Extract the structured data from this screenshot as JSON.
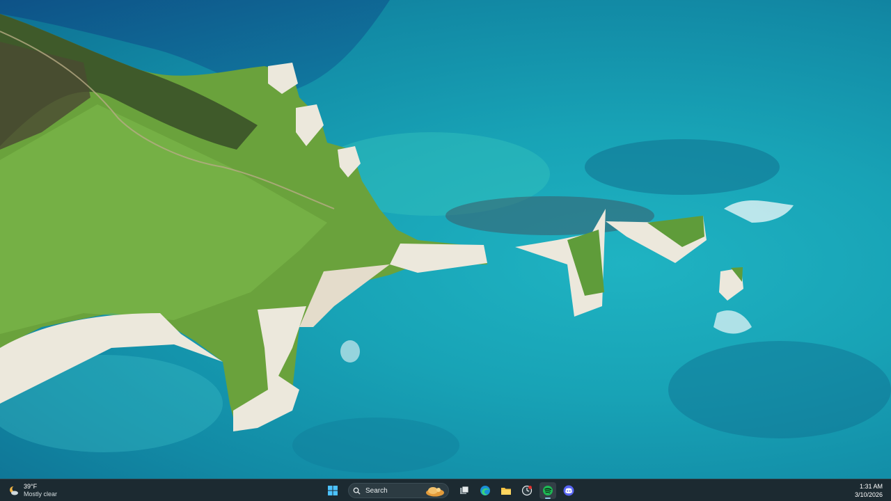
{
  "taskbar": {
    "weather": {
      "icon": "partly-cloudy-night-icon",
      "temperature": "39°F",
      "condition": "Mostly clear"
    },
    "start": {
      "icon": "windows-start-icon"
    },
    "search": {
      "label": "Search",
      "icon": "search-icon"
    },
    "apps": [
      {
        "name": "task-view",
        "icon": "task-view-icon"
      },
      {
        "name": "edge",
        "icon": "edge-icon"
      },
      {
        "name": "file-explorer",
        "icon": "folder-icon"
      },
      {
        "name": "clock-app",
        "icon": "clock-icon"
      },
      {
        "name": "spotify",
        "icon": "spotify-icon",
        "active": true
      },
      {
        "name": "discord",
        "icon": "discord-icon"
      }
    ],
    "clock": {
      "time": "1:31 AM",
      "date": "3/10/2026"
    }
  },
  "colors": {
    "taskbar_bg": "#1c2a31",
    "sea": "#18a3b6",
    "grass": "#6aa23c",
    "chalk": "#ece8dc",
    "spotify": "#1db954",
    "discord": "#5865f2"
  }
}
